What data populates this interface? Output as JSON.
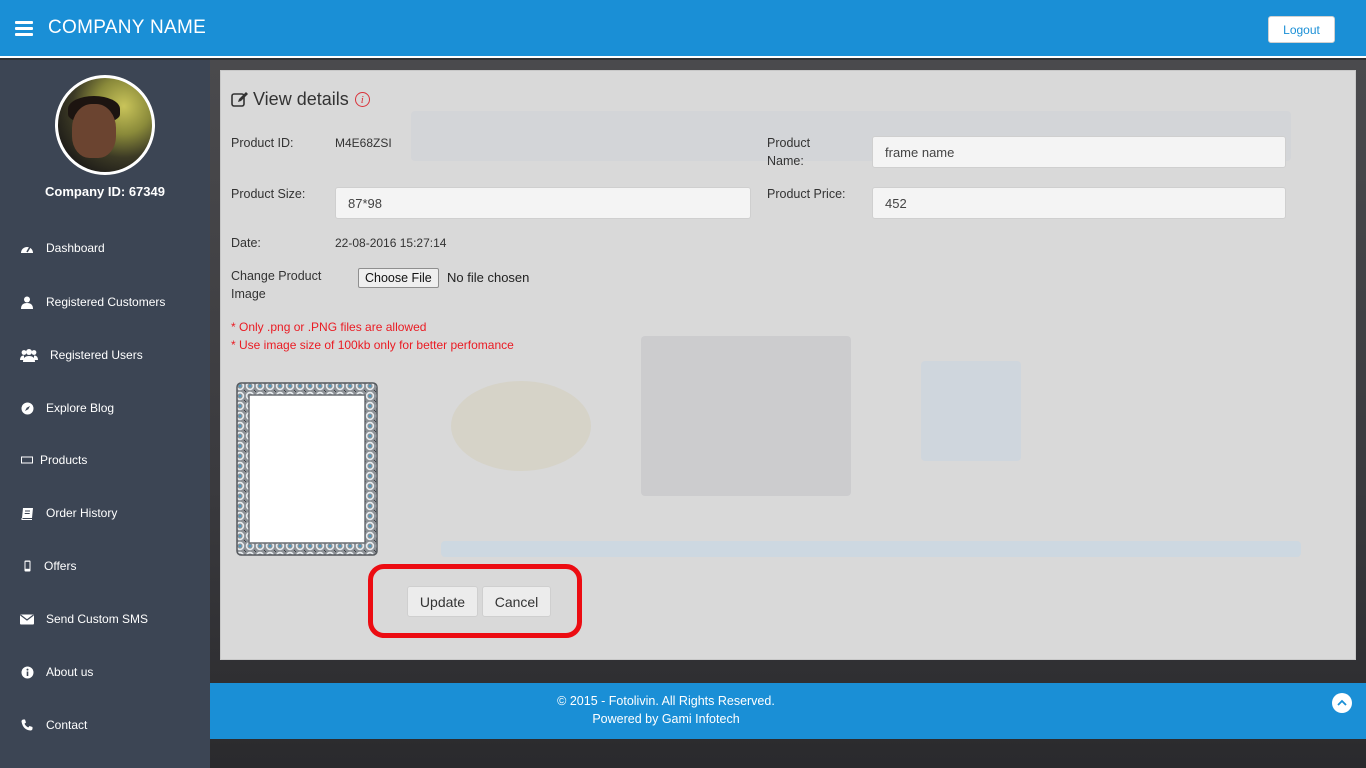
{
  "header": {
    "brand": "COMPANY NAME",
    "logout_label": "Logout"
  },
  "sidebar": {
    "company_id": "Company ID: 67349",
    "items": [
      {
        "label": "Dashboard",
        "icon": "dashboard-icon"
      },
      {
        "label": "Registered Customers",
        "icon": "user-icon"
      },
      {
        "label": "Registered Users",
        "icon": "users-icon"
      },
      {
        "label": "Explore Blog",
        "icon": "compass-icon"
      },
      {
        "label": "Products",
        "icon": "product-icon"
      },
      {
        "label": "Order History",
        "icon": "book-icon"
      },
      {
        "label": "Offers",
        "icon": "mobile-icon"
      },
      {
        "label": "Send Custom SMS",
        "icon": "envelope-icon"
      },
      {
        "label": "About us",
        "icon": "info-icon"
      },
      {
        "label": "Contact",
        "icon": "phone-icon"
      }
    ]
  },
  "details": {
    "title": "View details",
    "product_id_label": "Product ID:",
    "product_id_value": "M4E68ZSI",
    "product_name_label": "Product Name:",
    "product_name_value": "frame name",
    "product_size_label": "Product Size:",
    "product_size_value": "87*98",
    "product_price_label": "Product Price:",
    "product_price_value": "452",
    "date_label": "Date:",
    "date_value": "22-08-2016 15:27:14",
    "change_image_label": "Change Product Image",
    "choose_file_label": "Choose File",
    "no_file_text": "No file chosen",
    "warning_1": "* Only .png or .PNG files are allowed",
    "warning_2": "* Use image size of 100kb only for better perfomance",
    "update_label": "Update",
    "cancel_label": "Cancel"
  },
  "footer": {
    "copyright": "© 2015 - Fotolivin. All Rights Reserved.",
    "powered_by": "Powered by Gami Infotech"
  },
  "colors": {
    "primary": "#1a8fd6",
    "sidebar": "#3c4554",
    "warning": "#ea1b23",
    "highlight": "#ec0c12"
  }
}
